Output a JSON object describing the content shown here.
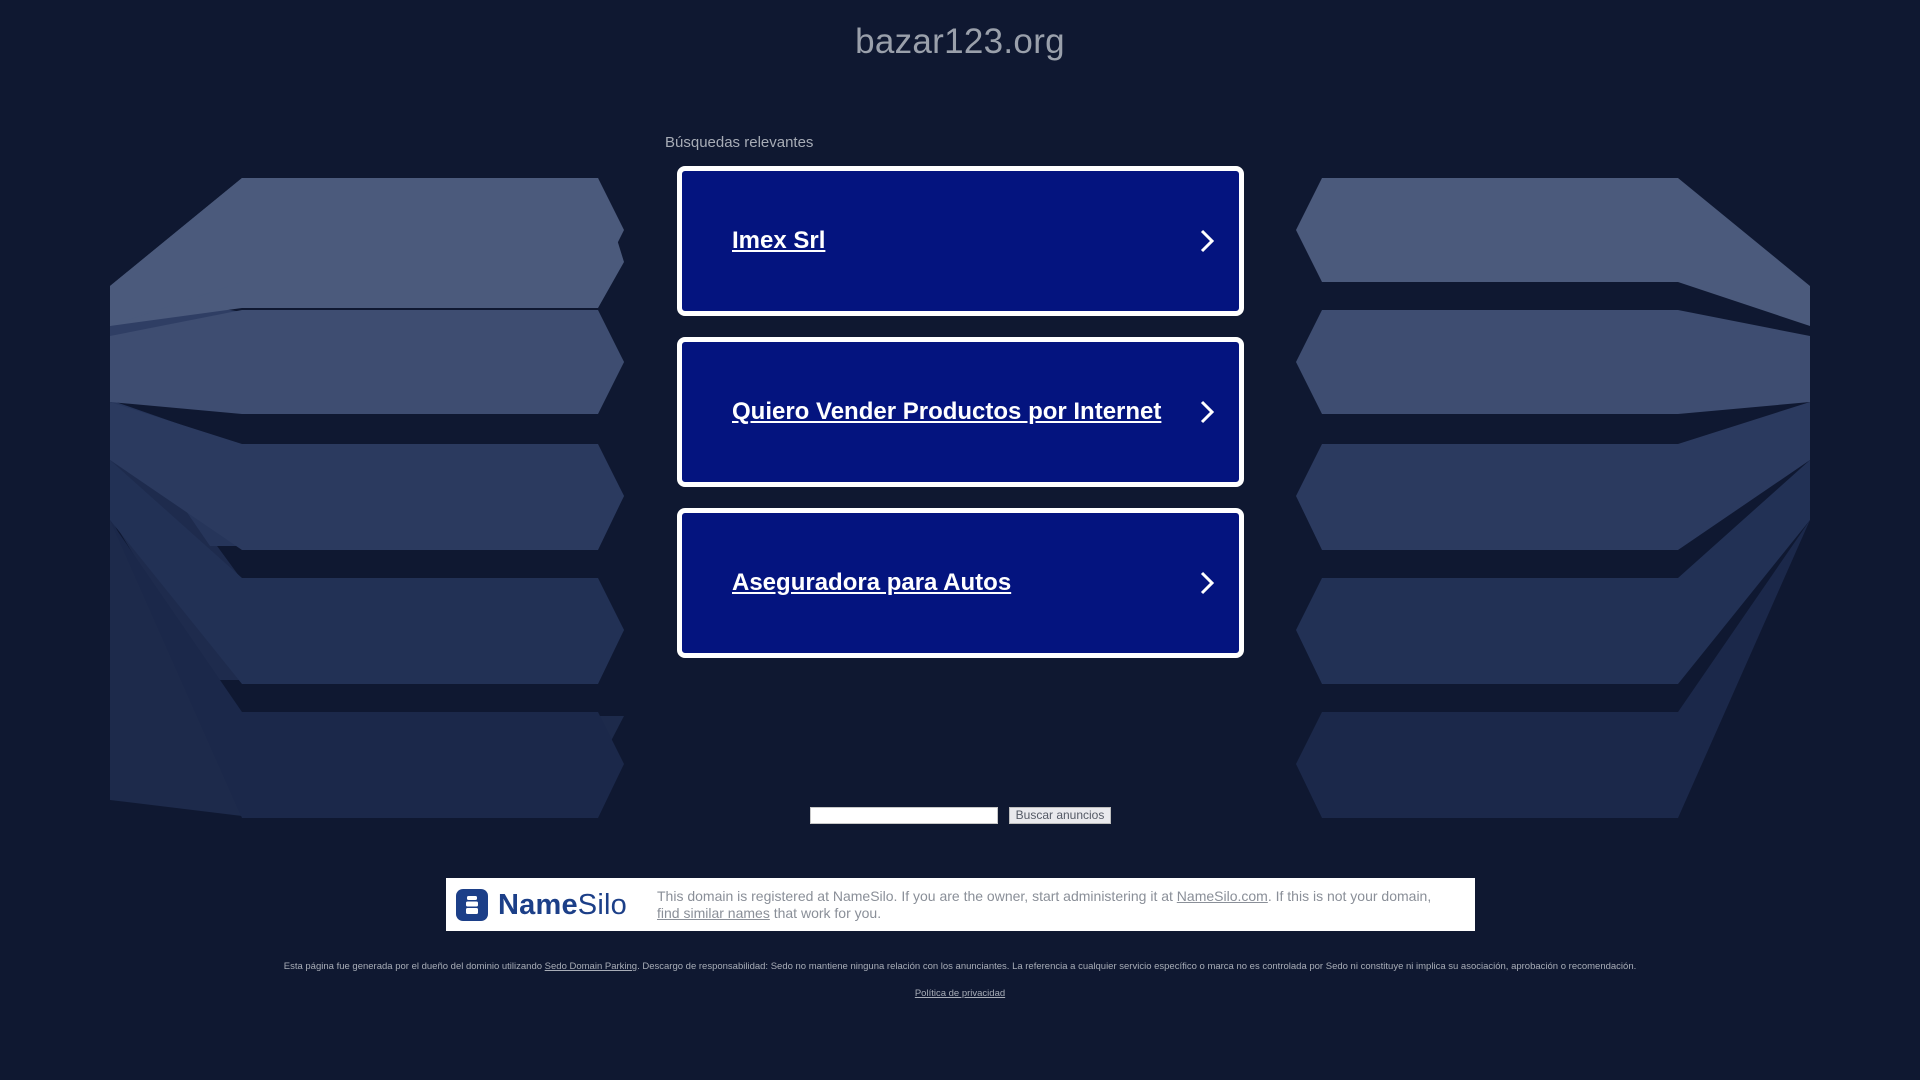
{
  "page": {
    "domain_title": "bazar123.org",
    "background_color": "#0f1831"
  },
  "searches": {
    "heading": "Búsquedas relevantes",
    "items": [
      {
        "label": "Imex Srl"
      },
      {
        "label": "Quiero Vender Productos por Internet"
      },
      {
        "label": "Aseguradora para Autos"
      }
    ],
    "box_color": "#04147f",
    "border_color": "#ffffff"
  },
  "search_form": {
    "input_value": "",
    "button_label": "Buscar anuncios"
  },
  "namesilo": {
    "logo_name": "NameSilo",
    "logo_name_bold": "Name",
    "logo_name_regular": "Silo",
    "logo_icon": "namesilo-stack-icon",
    "brand_color": "#1c3f88",
    "text_before_link": "This domain is registered at NameSilo. If you are the owner, start administering it at ",
    "link1": "NameSilo.com",
    "text_between": ". If this is not your domain, ",
    "link2": "find similar names",
    "text_after": " that work for you."
  },
  "footer": {
    "disclaimer_before": "Esta página fue generada por el dueño del dominio utilizando ",
    "disclaimer_link": "Sedo Domain Parking",
    "disclaimer_after": ". Descargo de responsabilidad: Sedo no mantiene ninguna relación con los anunciantes. La referencia a cualquier servicio específico o marca no es controlada por Sedo ni constituye ni implica su asociación, aprobación o recomendación.",
    "privacy_label": "Política de privacidad"
  },
  "icons": {
    "chevron": "chevron-right-icon"
  }
}
